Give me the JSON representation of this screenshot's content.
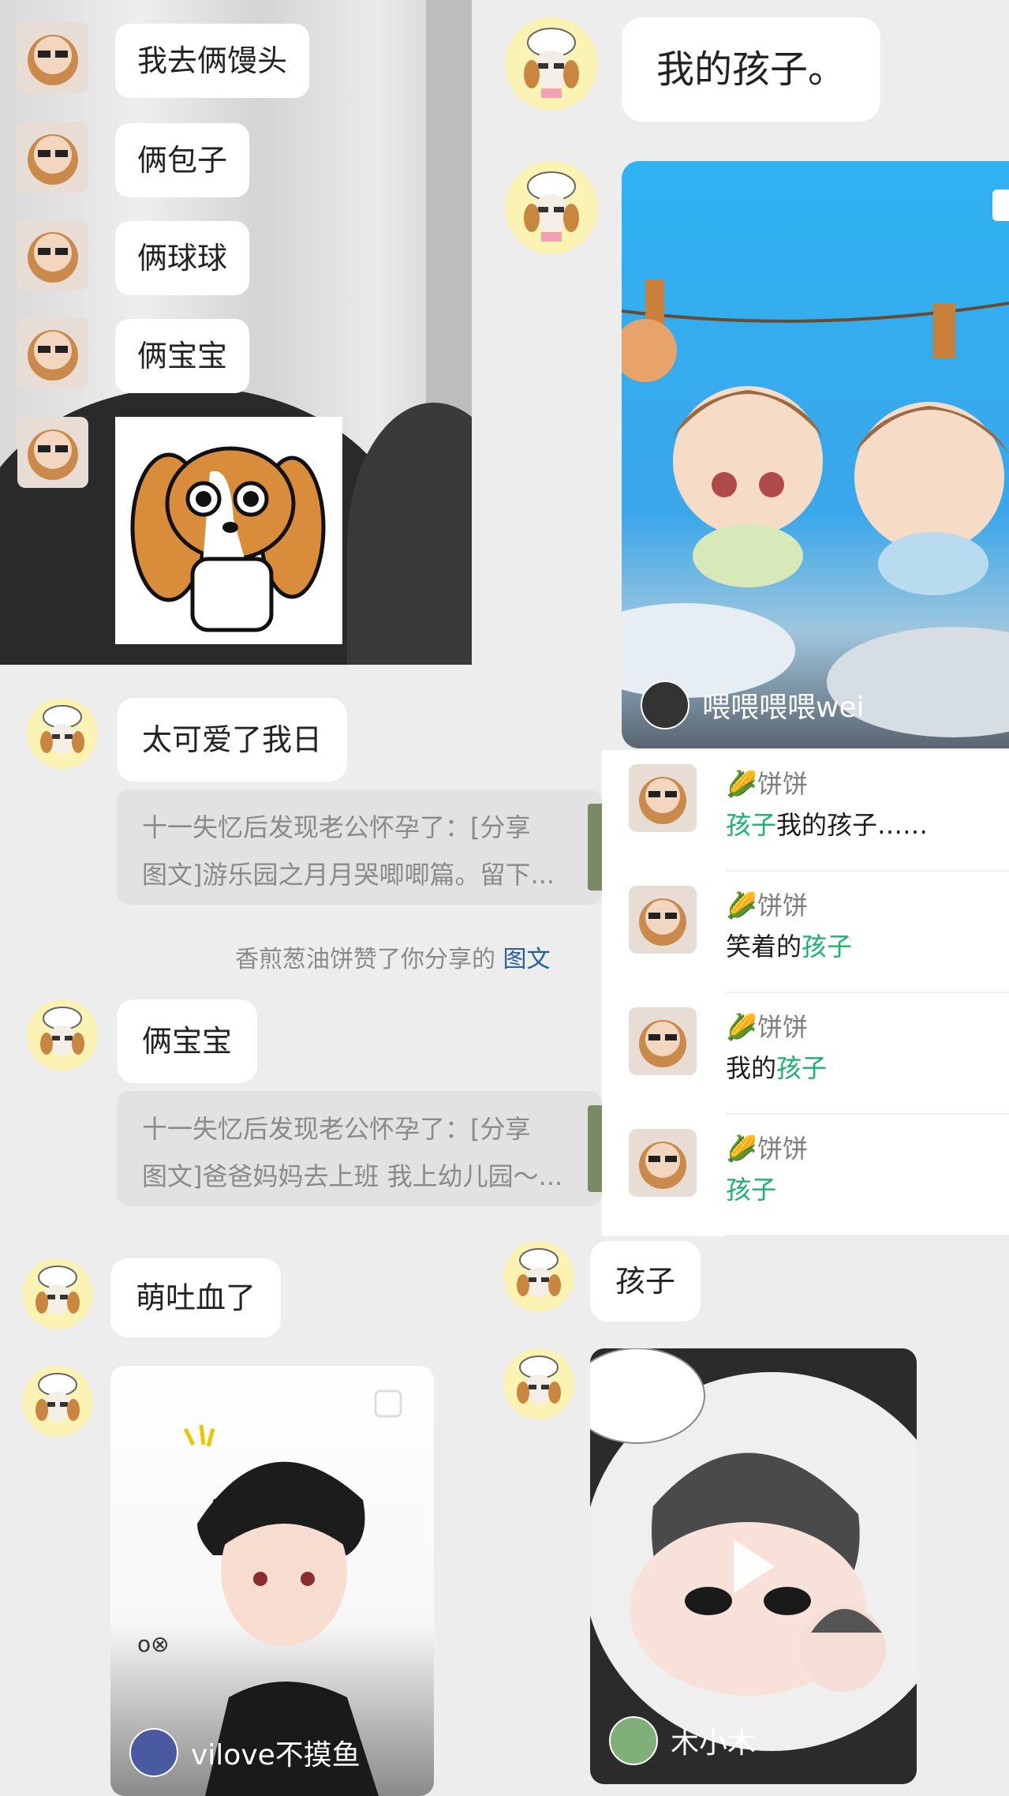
{
  "left_photo": {
    "messages": [
      "我去俩馒头",
      "俩包子",
      "俩球球",
      "俩宝宝"
    ]
  },
  "chat_right_top": {
    "message": "我的孩子。",
    "card_credit": "喂喂喂喂wei"
  },
  "comments": [
    {
      "name": "饼饼",
      "hl_before": "孩子",
      "text": "我的孩子……",
      "hl_after": ""
    },
    {
      "name": "饼饼",
      "hl_before": "",
      "text": "笑着的",
      "hl_after": "孩子"
    },
    {
      "name": "饼饼",
      "hl_before": "",
      "text": "我的",
      "hl_after": "孩子"
    },
    {
      "name": "饼饼",
      "hl_before": "孩子",
      "text": "",
      "hl_after": ""
    }
  ],
  "chat_left": {
    "msg1": "太可爱了我日",
    "share1": {
      "line1": "十一失忆后发现老公怀孕了：[分享",
      "line2": "图文]游乐园之月月哭唧唧篇。留下..."
    },
    "system": {
      "text": "香煎葱油饼赞了你分享的",
      "link": "图文"
    },
    "msg2": "俩宝宝",
    "share2": {
      "line1": "十一失忆后发现老公怀孕了：[分享",
      "line2": "图文]爸爸妈妈去上班 我上幼儿园～..."
    },
    "msg3": "萌吐血了",
    "card_credit": "vilove不摸鱼"
  },
  "chat_right_bottom": {
    "message": "孩子",
    "card_credit": "木小木"
  }
}
